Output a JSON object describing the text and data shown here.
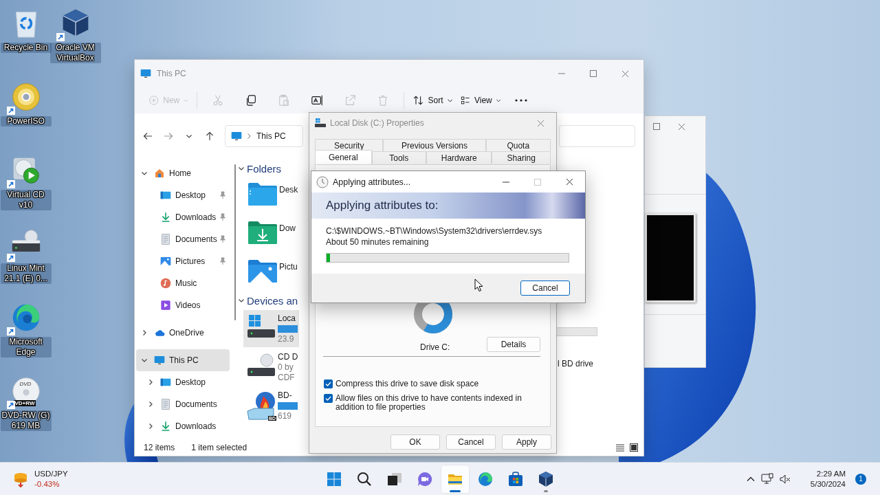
{
  "desktop": {
    "columns": [
      {
        "icons": [
          {
            "kind": "recycle-bin",
            "label": "Recycle Bin",
            "shortcut": false
          },
          {
            "kind": "disc",
            "label": "PowerISO",
            "shortcut": true
          },
          {
            "kind": "virtual-cd",
            "label": "Virtual CD v10",
            "shortcut": true
          },
          {
            "kind": "drive",
            "label": "Linux Mint 21.1 (E) 0...",
            "shortcut": true
          },
          {
            "kind": "edge",
            "label": "Microsoft Edge",
            "shortcut": true
          },
          {
            "kind": "dvd",
            "label": "DVD-RW (G) 619 MB",
            "shortcut": true,
            "disc_text": "DVD",
            "badge": "VD+RW"
          }
        ]
      },
      {
        "icons": [
          {
            "kind": "virtualbox",
            "label": "Oracle VM VirtualBox",
            "shortcut": true
          }
        ]
      }
    ]
  },
  "explorer": {
    "title": "This PC",
    "toolbar": [
      {
        "kind": "new",
        "label": "New",
        "disabled": true
      },
      {
        "kind": "cut",
        "disabled": true
      },
      {
        "kind": "copy",
        "disabled": false
      },
      {
        "kind": "paste",
        "disabled": true
      },
      {
        "kind": "rename",
        "disabled": false
      },
      {
        "kind": "share",
        "disabled": true
      },
      {
        "kind": "delete",
        "disabled": true
      },
      {
        "kind": "sort",
        "label": "Sort",
        "disabled": false
      },
      {
        "kind": "view",
        "label": "View",
        "disabled": false
      },
      {
        "kind": "more",
        "disabled": false
      }
    ],
    "address": "This PC",
    "nav": [
      {
        "label": "Home",
        "kind": "home",
        "expanded": true,
        "selected": false,
        "children": [
          {
            "label": "Desktop",
            "kind": "desktop",
            "pinned": true,
            "selected": false
          },
          {
            "label": "Downloads",
            "kind": "downloads",
            "pinned": true,
            "selected": false
          },
          {
            "label": "Documents",
            "kind": "documents",
            "pinned": true,
            "selected": false
          },
          {
            "label": "Pictures",
            "kind": "pictures",
            "pinned": true,
            "selected": false
          },
          {
            "label": "Music",
            "kind": "music",
            "pinned": false,
            "selected": false
          },
          {
            "label": "Videos",
            "kind": "videos",
            "pinned": false,
            "selected": false
          }
        ]
      },
      {
        "label": "OneDrive",
        "kind": "onedrive",
        "expanded": false,
        "selected": false
      },
      {
        "label": "This PC",
        "kind": "pc",
        "expanded": true,
        "selected": true,
        "children": [
          {
            "label": "Desktop",
            "kind": "desktop",
            "expanded": false,
            "selected": false
          },
          {
            "label": "Documents",
            "kind": "documents",
            "expanded": false,
            "selected": false
          },
          {
            "label": "Downloads",
            "kind": "downloads",
            "expanded": false,
            "selected": false
          }
        ]
      }
    ],
    "sections": [
      {
        "title": "Folders",
        "expanded": true,
        "kind": "folders",
        "items": [
          {
            "kind": "desktop-folder",
            "name": "Desk"
          },
          {
            "kind": "downloads-folder",
            "name": "Dow"
          },
          {
            "kind": "pictures-folder",
            "name": "Pictu"
          }
        ]
      },
      {
        "title": "Devices an",
        "expanded": true,
        "kind": "devices",
        "items": [
          {
            "kind": "local-disk",
            "name": "Loca",
            "lines": [
              "23.9"
            ],
            "bar": true,
            "selected": true,
            "tail": {
              "kind": "track"
            }
          },
          {
            "kind": "cd-drive",
            "name": "CD D",
            "lines": [
              "0 by",
              "CDF"
            ],
            "bar": false,
            "selected": false,
            "tail": {
              "kind": "text",
              "text": "l BD drive"
            }
          },
          {
            "kind": "bd-drive",
            "badge": "BD",
            "name": "BD-",
            "lines": [
              "619"
            ],
            "bar": true,
            "selected": false
          }
        ]
      }
    ],
    "status": {
      "count": "12 items",
      "selection": "1 item selected"
    }
  },
  "properties": {
    "title": "Local Disk (C:) Properties",
    "tab_rows": [
      {
        "tabs": [
          {
            "label": "Security",
            "selected": false
          },
          {
            "label": "Previous Versions",
            "selected": false
          },
          {
            "label": "Quota",
            "selected": false
          }
        ]
      },
      {
        "tabs": [
          {
            "label": "General",
            "selected": true
          },
          {
            "label": "Tools",
            "selected": false
          },
          {
            "label": "Hardware",
            "selected": false
          },
          {
            "label": "Sharing",
            "selected": false
          }
        ]
      }
    ],
    "drive_label": "Drive C:",
    "details_button": "Details",
    "options": [
      {
        "label": "Compress this drive to save disk space",
        "checked": true
      },
      {
        "label": "Allow files on this drive to have contents indexed in addition to file properties",
        "checked": true
      }
    ],
    "buttons": [
      {
        "label": "OK",
        "default": false
      },
      {
        "label": "Cancel",
        "default": false
      },
      {
        "label": "Apply",
        "default": false
      }
    ]
  },
  "progress_dialog": {
    "title": "Applying attributes...",
    "maximize_disabled": true,
    "heading": "Applying attributes to:",
    "path": "C:\\$WINDOWS.~BT\\Windows\\System32\\drivers\\errdev.sys",
    "remaining": "About 50 minutes remaining",
    "level": 0.015,
    "cancel": "Cancel"
  },
  "taskbar": {
    "widget": {
      "symbol": "USD/JPY",
      "change": "-0.43%"
    },
    "apps": [
      {
        "kind": "start",
        "running": false,
        "active": false
      },
      {
        "kind": "search",
        "running": false,
        "active": false
      },
      {
        "kind": "task-view",
        "running": false,
        "active": false
      },
      {
        "kind": "chat",
        "running": false,
        "active": false
      },
      {
        "kind": "file-explorer",
        "running": true,
        "active": true
      },
      {
        "kind": "edge",
        "running": false,
        "active": false
      },
      {
        "kind": "store",
        "running": false,
        "active": false
      },
      {
        "kind": "virtualbox",
        "running": true,
        "active": false
      }
    ],
    "time": "2:29 AM",
    "date": "5/30/2024",
    "notifications": "1"
  }
}
